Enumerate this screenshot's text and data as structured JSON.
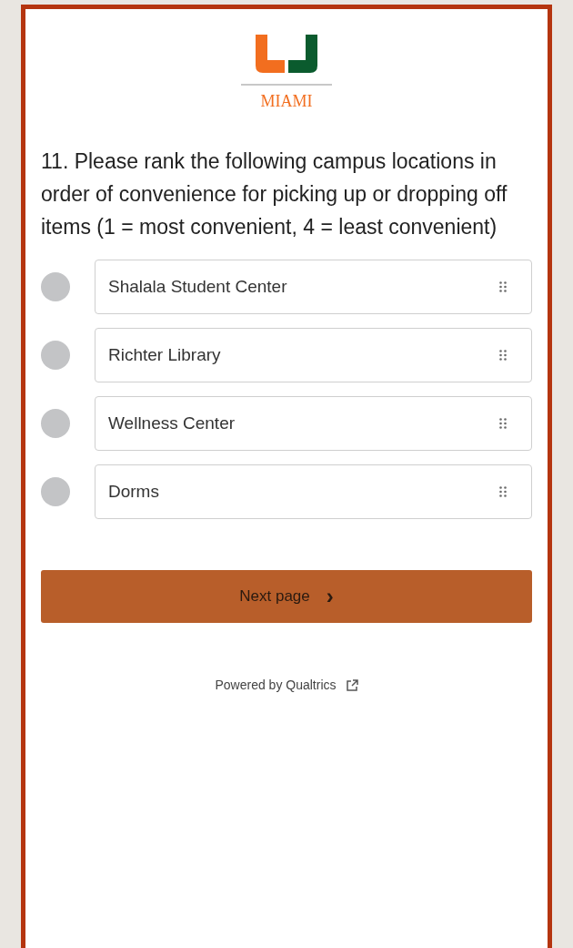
{
  "logo": {
    "wordmark": "MIAMI"
  },
  "question": "11. Please rank the following campus locations in order of convenience for picking up or dropping off items (1 = most convenient, 4 = least convenient)",
  "choices": [
    {
      "label": "Shalala Student Center"
    },
    {
      "label": "Richter Library"
    },
    {
      "label": "Wellness Center"
    },
    {
      "label": "Dorms"
    }
  ],
  "next_button": {
    "label": "Next page",
    "icon": "›"
  },
  "footer": {
    "text": "Powered by Qualtrics"
  }
}
